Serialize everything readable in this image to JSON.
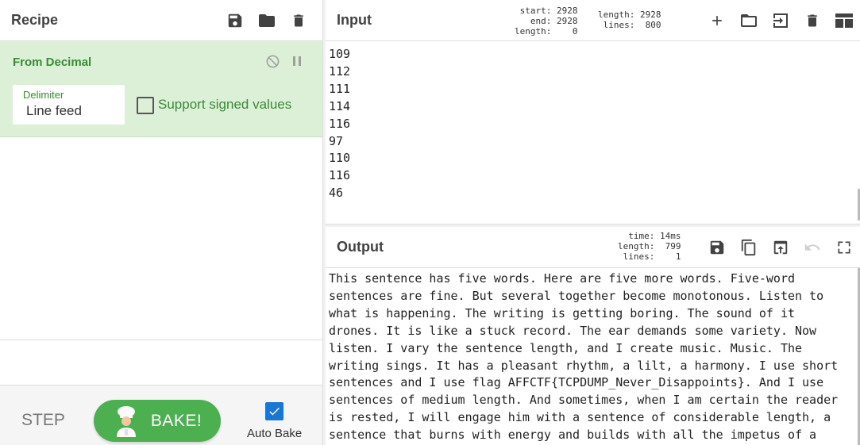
{
  "recipe": {
    "title": "Recipe",
    "icons": [
      "save-icon",
      "folder-icon",
      "trash-icon"
    ],
    "operation": {
      "name": "From Decimal",
      "delimiter_label": "Delimiter",
      "delimiter_value": "Line feed",
      "signed_label": "Support signed values",
      "signed_checked": false
    }
  },
  "controls": {
    "step_label": "STEP",
    "bake_label": "BAKE!",
    "autobake_label": "Auto Bake",
    "autobake_checked": true
  },
  "input": {
    "title": "Input",
    "stats_left": "start: 2928\n  end: 2928\nlength:    0",
    "stats_right": "length: 2928\n lines:  800",
    "lines": [
      "109",
      "112",
      "111",
      "114",
      "116",
      "97",
      "110",
      "116",
      "46"
    ]
  },
  "output": {
    "title": "Output",
    "stats": "  time: 14ms\nlength:  799\n lines:    1",
    "lines": [
      "This sentence has five words. Here are five more words. Five-word",
      "sentences are fine. But several together become monotonous. Listen to",
      "what is happening. The writing is getting boring. The sound of it",
      "drones. It is like a stuck record. The ear demands some variety. Now",
      "listen. I vary the sentence length, and I create music. Music. The",
      "writing sings. It has a pleasant rhythm, a lilt, a harmony. I use short",
      "sentences and I use flag AFFCTF{TCPDUMP_Never_Disappoints}. And I use",
      "sentences of medium length. And sometimes, when I am certain the reader",
      "is rested, I will engage him with a sentence of considerable length, a",
      "sentence that burns with energy and builds with all the impetus of a"
    ]
  },
  "colors": {
    "operation_bg": "#dcf0d7",
    "operation_text": "#3a8a38",
    "bake_button": "#4caf50",
    "autobake_check": "#1976d2"
  }
}
